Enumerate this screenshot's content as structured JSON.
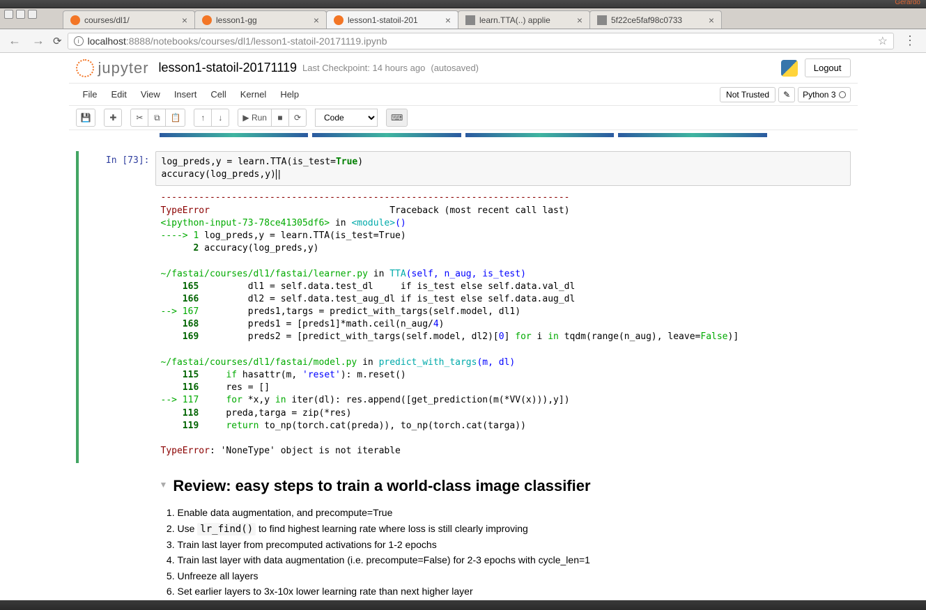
{
  "titlebar": {
    "user": "Gerardo"
  },
  "tabs": [
    {
      "title": "courses/dl1/",
      "favicon": "#f37626"
    },
    {
      "title": "lesson1-gg",
      "favicon": "#f37626"
    },
    {
      "title": "lesson1-statoil-201",
      "favicon": "#f37626",
      "active": true
    },
    {
      "title": "learn.TTA(..) applie",
      "favicon": "#888"
    },
    {
      "title": "5f22ce5faf98c0733",
      "favicon": "#888"
    }
  ],
  "url": {
    "prefix": "localhost",
    "port": ":8888",
    "path": "/notebooks/courses/dl1/lesson1-statoil-20171119.ipynb"
  },
  "header": {
    "logo": "jupyter",
    "name": "lesson1-statoil-20171119",
    "checkpoint": "Last Checkpoint: 14 hours ago",
    "autosave": "(autosaved)",
    "logout": "Logout"
  },
  "menus": [
    "File",
    "Edit",
    "View",
    "Insert",
    "Cell",
    "Kernel",
    "Help"
  ],
  "trust": "Not Trusted",
  "kernel": "Python 3",
  "toolbar": {
    "run": "▶ Run",
    "celltype": "Code"
  },
  "code_cell": {
    "prompt": "In [73]:",
    "line1a": "log_preds,y = learn.TTA(is_test=",
    "line1b": "True",
    "line1c": ")",
    "line2": "accuracy(log_preds,y)"
  },
  "traceback": {
    "sep": "---------------------------------------------------------------------------",
    "err_name": "TypeError",
    "tb_label": "Traceback (most recent call last)",
    "frame_ipy": "<ipython-input-73-78ce41305df6>",
    "in": " in ",
    "module": "<module>",
    "parens": "()",
    "arrow1": "----> 1",
    "l1": " log_preds,y = learn.TTA(is_test=True)",
    "ln2": "      2",
    "l2": " accuracy(log_preds,y)",
    "path1": "~/fastai/courses/dl1/fastai/learner.py",
    "fn1": "TTA",
    "args1": "(self, n_aug, is_test)",
    "n165": "    165",
    "t165": "         dl1 = self.data.test_dl     if is_test else self.data.val_dl",
    "n166": "    166",
    "t166": "         dl2 = self.data.test_aug_dl if is_test else self.data.aug_dl",
    "arrow167": "--> 167",
    "t167": "         preds1,targs = predict_with_targs(self.model, dl1)",
    "n168": "    168",
    "t168a": "         preds1 = [preds1]*math.ceil(n_aug/",
    "t168b": "4",
    "t168c": ")",
    "n169": "    169",
    "t169a": "         preds2 = [predict_with_targs(self.model, dl2)[",
    "t169b": "0",
    "t169c": "] ",
    "t169d": "for",
    "t169e": " i ",
    "t169f": "in",
    "t169g": " tqdm(range(n_aug), leave=",
    "t169h": "False",
    "t169i": ")]",
    "path2": "~/fastai/courses/dl1/fastai/model.py",
    "fn2": "predict_with_targs",
    "args2": "(m, dl)",
    "n115": "    115",
    "t115a": "     ",
    "t115b": "if",
    "t115c": " hasattr(m, ",
    "t115d": "'reset'",
    "t115e": "): m.reset()",
    "n116": "    116",
    "t116": "     res = []",
    "arrow117": "--> 117",
    "t117a": "     ",
    "t117b": "for",
    "t117c": " *x,y ",
    "t117d": "in",
    "t117e": " iter(dl): res.append([get_prediction(m(*VV(x))),y])",
    "n118": "    118",
    "t118": "     preda,targa = zip(*res)",
    "n119": "    119",
    "t119a": "     ",
    "t119b": "return",
    "t119c": " to_np(torch.cat(preda)), to_np(torch.cat(targa))",
    "final_err": "TypeError",
    "final_msg": ": 'NoneType' object is not iterable"
  },
  "markdown": {
    "heading": "Review: easy steps to train a world-class image classifier",
    "items": [
      "Enable data augmentation, and precompute=True",
      "Use |lr_find()| to find highest learning rate where loss is still clearly improving",
      "Train last layer from precomputed activations for 1-2 epochs",
      "Train last layer with data augmentation (i.e. precompute=False) for 2-3 epochs with cycle_len=1",
      "Unfreeze all layers",
      "Set earlier layers to 3x-10x lower learning rate than next higher layer"
    ]
  }
}
